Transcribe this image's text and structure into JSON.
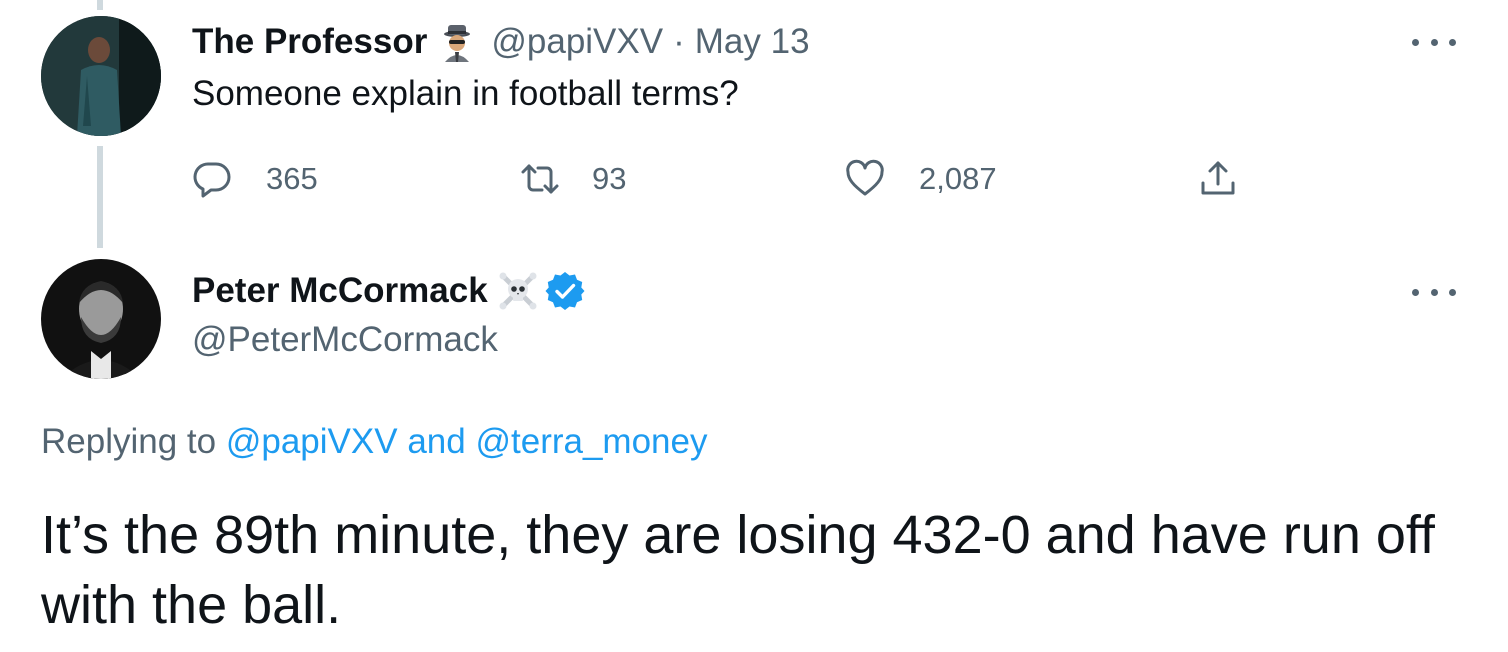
{
  "tweet1": {
    "display_name": "The Professor",
    "name_emoji": "detective-emoji",
    "handle": "@papiVXV",
    "separator": "·",
    "date": "May 13",
    "text": "Someone explain in football terms?",
    "stats": {
      "replies": "365",
      "retweets": "93",
      "likes": "2,087"
    }
  },
  "tweet2": {
    "display_name": "Peter McCormack",
    "name_emoji": "skull-and-crossbones-emoji",
    "verified": true,
    "handle": "@PeterMcCormack",
    "replying_prefix": "Replying to",
    "replying_user1": "@papiVXV",
    "replying_and": "and",
    "replying_user2": "@terra_money",
    "text": "It’s the 89th minute, they are losing 432-0 and have run off with the ball."
  },
  "colors": {
    "text_primary": "#0f1419",
    "text_secondary": "#536471",
    "link": "#1d9bf0",
    "thread_line": "#cfd9de"
  }
}
